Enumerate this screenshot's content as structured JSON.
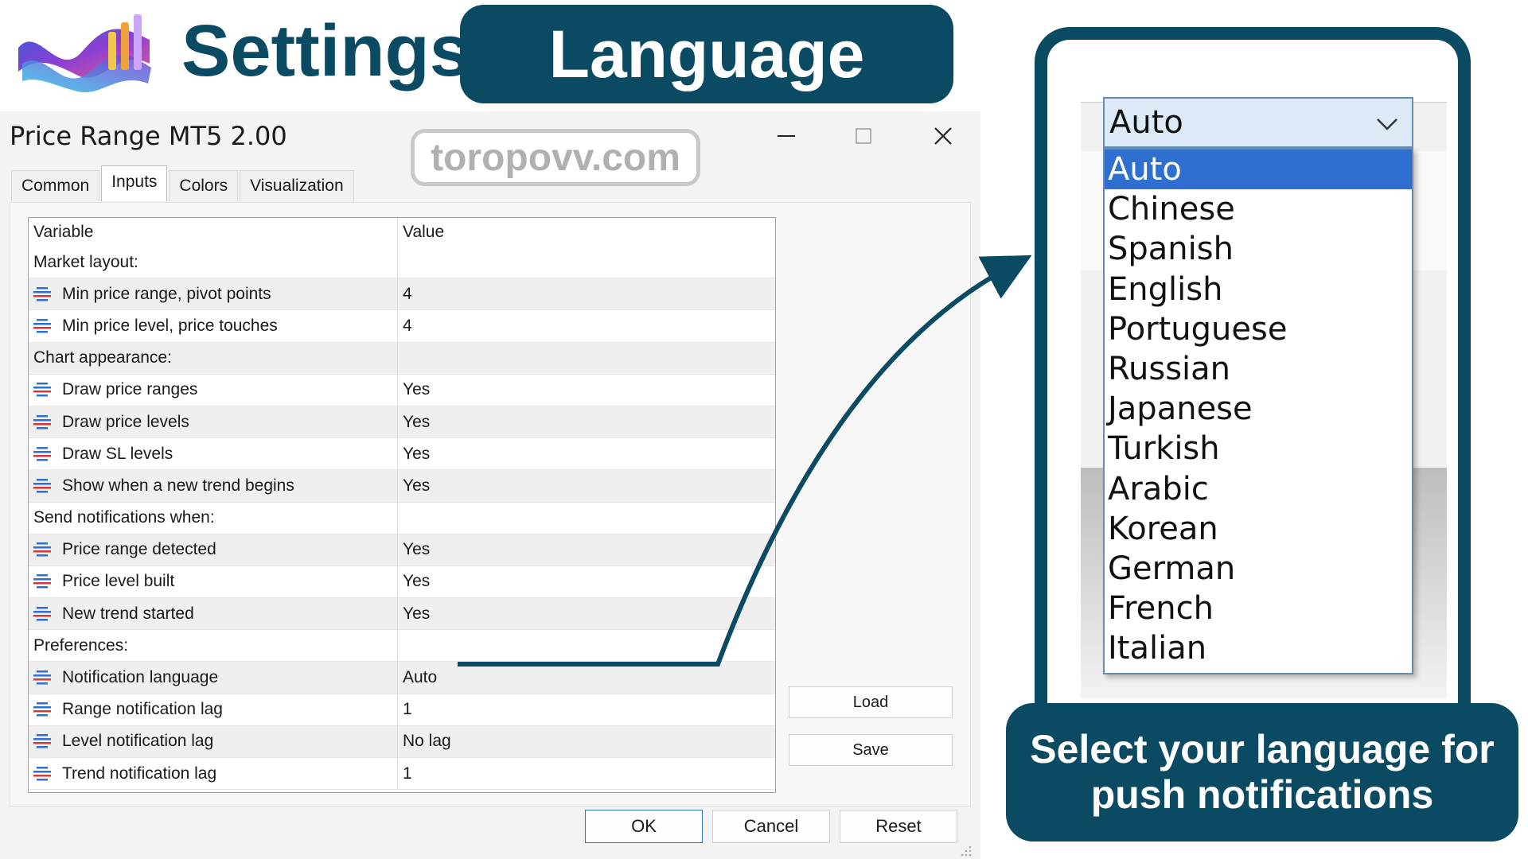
{
  "header": {
    "heading": "Settings",
    "banner": "Language"
  },
  "dialog": {
    "title": "Price Range MT5 2.00",
    "watermark": "toropovv.com",
    "tabs": [
      {
        "label": "Common",
        "active": false
      },
      {
        "label": "Inputs",
        "active": true
      },
      {
        "label": "Colors",
        "active": false
      },
      {
        "label": "Visualization",
        "active": false
      }
    ],
    "columns": {
      "variable": "Variable",
      "value": "Value"
    },
    "rows": [
      {
        "label": "Market layout:",
        "value": "",
        "section": true
      },
      {
        "label": "Min price range, pivot points",
        "value": "4"
      },
      {
        "label": "Min price level, price touches",
        "value": "4"
      },
      {
        "label": "Chart appearance:",
        "value": "",
        "section": true
      },
      {
        "label": "Draw price ranges",
        "value": "Yes"
      },
      {
        "label": "Draw price levels",
        "value": "Yes"
      },
      {
        "label": "Draw SL levels",
        "value": "Yes"
      },
      {
        "label": "Show when a new trend begins",
        "value": "Yes"
      },
      {
        "label": "Send notifications when:",
        "value": "",
        "section": true
      },
      {
        "label": "Price range detected",
        "value": "Yes"
      },
      {
        "label": "Price level built",
        "value": "Yes"
      },
      {
        "label": "New trend started",
        "value": "Yes"
      },
      {
        "label": "Preferences:",
        "value": "",
        "section": true
      },
      {
        "label": "Notification language",
        "value": "Auto"
      },
      {
        "label": "Range notification lag",
        "value": "1"
      },
      {
        "label": "Level notification lag",
        "value": "No lag"
      },
      {
        "label": "Trend notification lag",
        "value": "1"
      }
    ],
    "load_label": "Load",
    "save_label": "Save",
    "ok_label": "OK",
    "cancel_label": "Cancel",
    "reset_label": "Reset"
  },
  "language_select": {
    "value": "Auto",
    "options": [
      "Auto",
      "Chinese",
      "Spanish",
      "English",
      "Portuguese",
      "Russian",
      "Japanese",
      "Turkish",
      "Arabic",
      "Korean",
      "German",
      "French",
      "Italian"
    ],
    "selected_index": 0
  },
  "caption": "Select your language for push notifications",
  "colors": {
    "brand": "#0b4a63",
    "selection": "#2f6fd0",
    "row_icon_blue": "#2f6fd0",
    "row_icon_red": "#d03a3a"
  },
  "icons": {
    "row": "input-parameter-icon",
    "minimize": "minimize-icon",
    "maximize": "maximize-icon",
    "close": "close-icon",
    "dropdown": "chevron-down-icon"
  }
}
